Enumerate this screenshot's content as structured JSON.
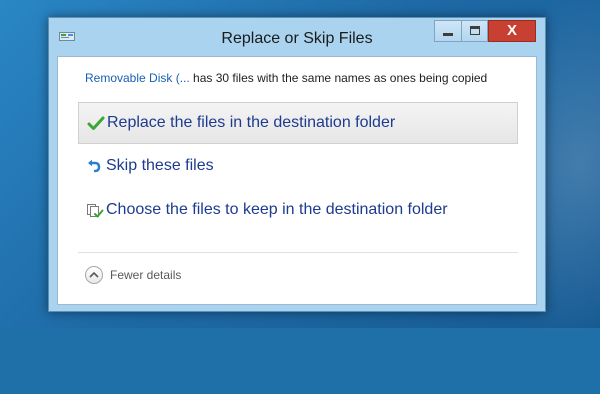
{
  "window": {
    "title": "Replace or Skip Files",
    "close_glyph": "X"
  },
  "source": {
    "name": "Removable Disk (...",
    "message": " has 30 files with the same names as ones being copied"
  },
  "options": [
    {
      "label": "Replace the files in the destination folder",
      "icon": "checkmark-icon",
      "selected": true
    },
    {
      "label": "Skip these files",
      "icon": "skip-arrow-icon",
      "selected": false
    },
    {
      "label": "Choose the files to keep in the destination folder",
      "icon": "choose-files-icon",
      "selected": false
    }
  ],
  "details": {
    "label": "Fewer details",
    "icon": "chevron-up-icon"
  },
  "colors": {
    "link": "#1a5fb4",
    "option_text": "#1d3b8f",
    "close_button": "#c84031",
    "checkmark": "#3da535"
  }
}
